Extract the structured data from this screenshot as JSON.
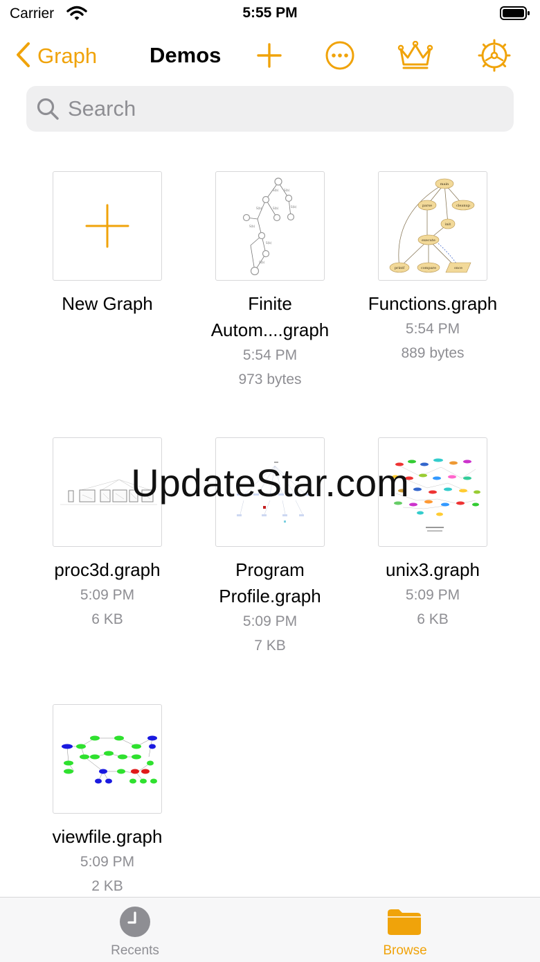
{
  "status": {
    "carrier": "Carrier",
    "time": "5:55 PM"
  },
  "nav": {
    "back_label": "Graph",
    "title": "Demos"
  },
  "search": {
    "placeholder": "Search"
  },
  "files": [
    {
      "name": "New Graph",
      "time": "",
      "size": ""
    },
    {
      "name": "Finite Autom....graph",
      "time": "5:54 PM",
      "size": "973 bytes"
    },
    {
      "name": "Functions.graph",
      "time": "5:54 PM",
      "size": "889 bytes"
    },
    {
      "name": "proc3d.graph",
      "time": "5:09 PM",
      "size": "6 KB"
    },
    {
      "name": "Program Profile.graph",
      "time": "5:09 PM",
      "size": "7 KB"
    },
    {
      "name": "unix3.graph",
      "time": "5:09 PM",
      "size": "6 KB"
    },
    {
      "name": "viewfile.graph",
      "time": "5:09 PM",
      "size": "2 KB"
    }
  ],
  "thumb_texts": {
    "functions": [
      "main",
      "parse",
      "cleanup",
      "init",
      "execute",
      "printf",
      "compare",
      "once"
    ]
  },
  "watermark": "UpdateStar.com",
  "tabs": [
    {
      "label": "Recents",
      "icon": "clock-icon",
      "active": false
    },
    {
      "label": "Browse",
      "icon": "folder-icon",
      "active": true
    }
  ],
  "colors": {
    "accent": "#f0a30a",
    "inactive": "#8e8e93"
  }
}
